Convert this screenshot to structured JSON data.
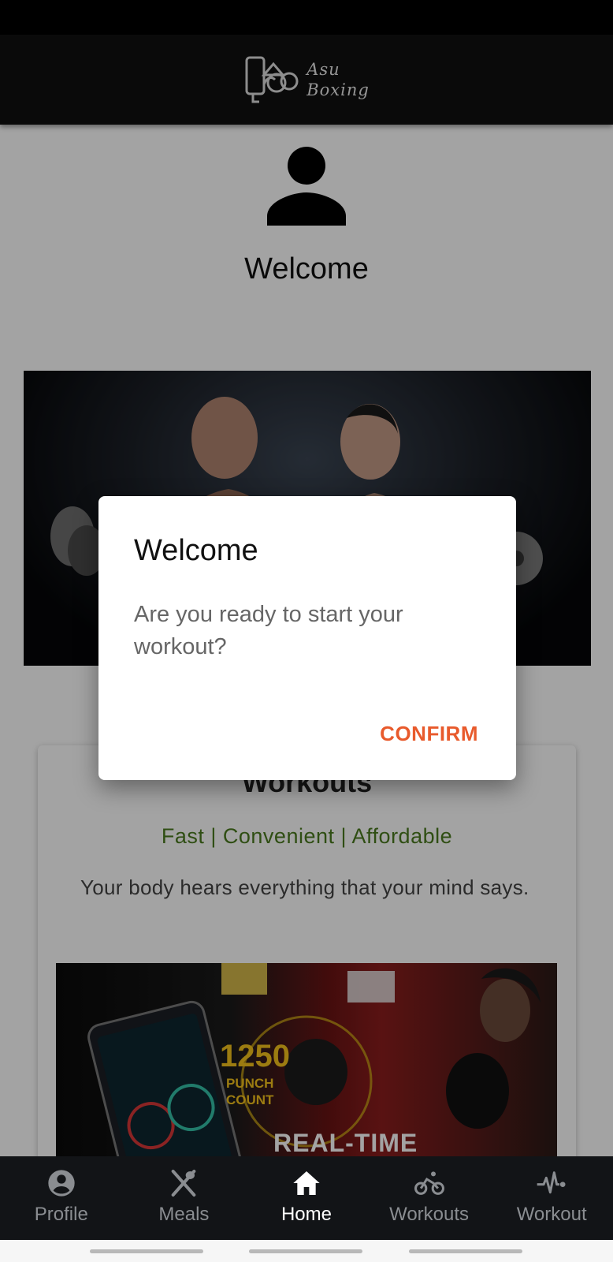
{
  "app": {
    "logo_line1": "Asu",
    "logo_line2": "Boxing"
  },
  "page": {
    "welcome": "Welcome"
  },
  "card": {
    "title": "Workouts",
    "tagline": "Fast | Convenient | Affordable",
    "quote": "Your body hears everything that your mind says.",
    "promo_count": "1250",
    "promo_sub_line1": "PUNCH",
    "promo_sub_line2": "COUNT",
    "promo_headline": "REAL-TIME"
  },
  "dialog": {
    "title": "Welcome",
    "message": "Are you ready to start your workout?",
    "confirm_label": "CONFIRM",
    "confirm_color": "#e85a2c"
  },
  "bottom_nav": {
    "items": [
      {
        "label": "Profile",
        "icon": "account-circle-icon"
      },
      {
        "label": "Meals",
        "icon": "fork-spoon-icon"
      },
      {
        "label": "Home",
        "icon": "home-icon",
        "active": true
      },
      {
        "label": "Workouts",
        "icon": "bicycle-icon"
      },
      {
        "label": "Workout",
        "icon": "heartbeat-icon"
      }
    ]
  }
}
